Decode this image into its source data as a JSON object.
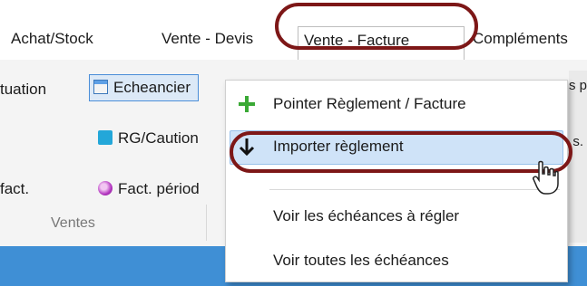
{
  "tabs": [
    "Achat/Stock",
    "Vente - Devis",
    "Vente - Facture",
    "Compléments"
  ],
  "ribbon": {
    "left_items": [
      "tuation",
      "fact."
    ],
    "buttons": [
      "Echeancier",
      "RG/Caution",
      "Fact. périod"
    ],
    "group_label": "Ventes",
    "right_edge_text": "s p",
    "right_edge_text2": "s."
  },
  "context_menu": {
    "items": [
      "Pointer Règlement / Facture",
      "Importer règlement",
      "Voir les échéances à régler",
      "Voir toutes les échéances"
    ]
  },
  "colors": {
    "annotation": "#7d1717",
    "plus": "#3aa935",
    "highlight": "#cfe3f8",
    "bottom_bar": "#3f8fd5"
  }
}
